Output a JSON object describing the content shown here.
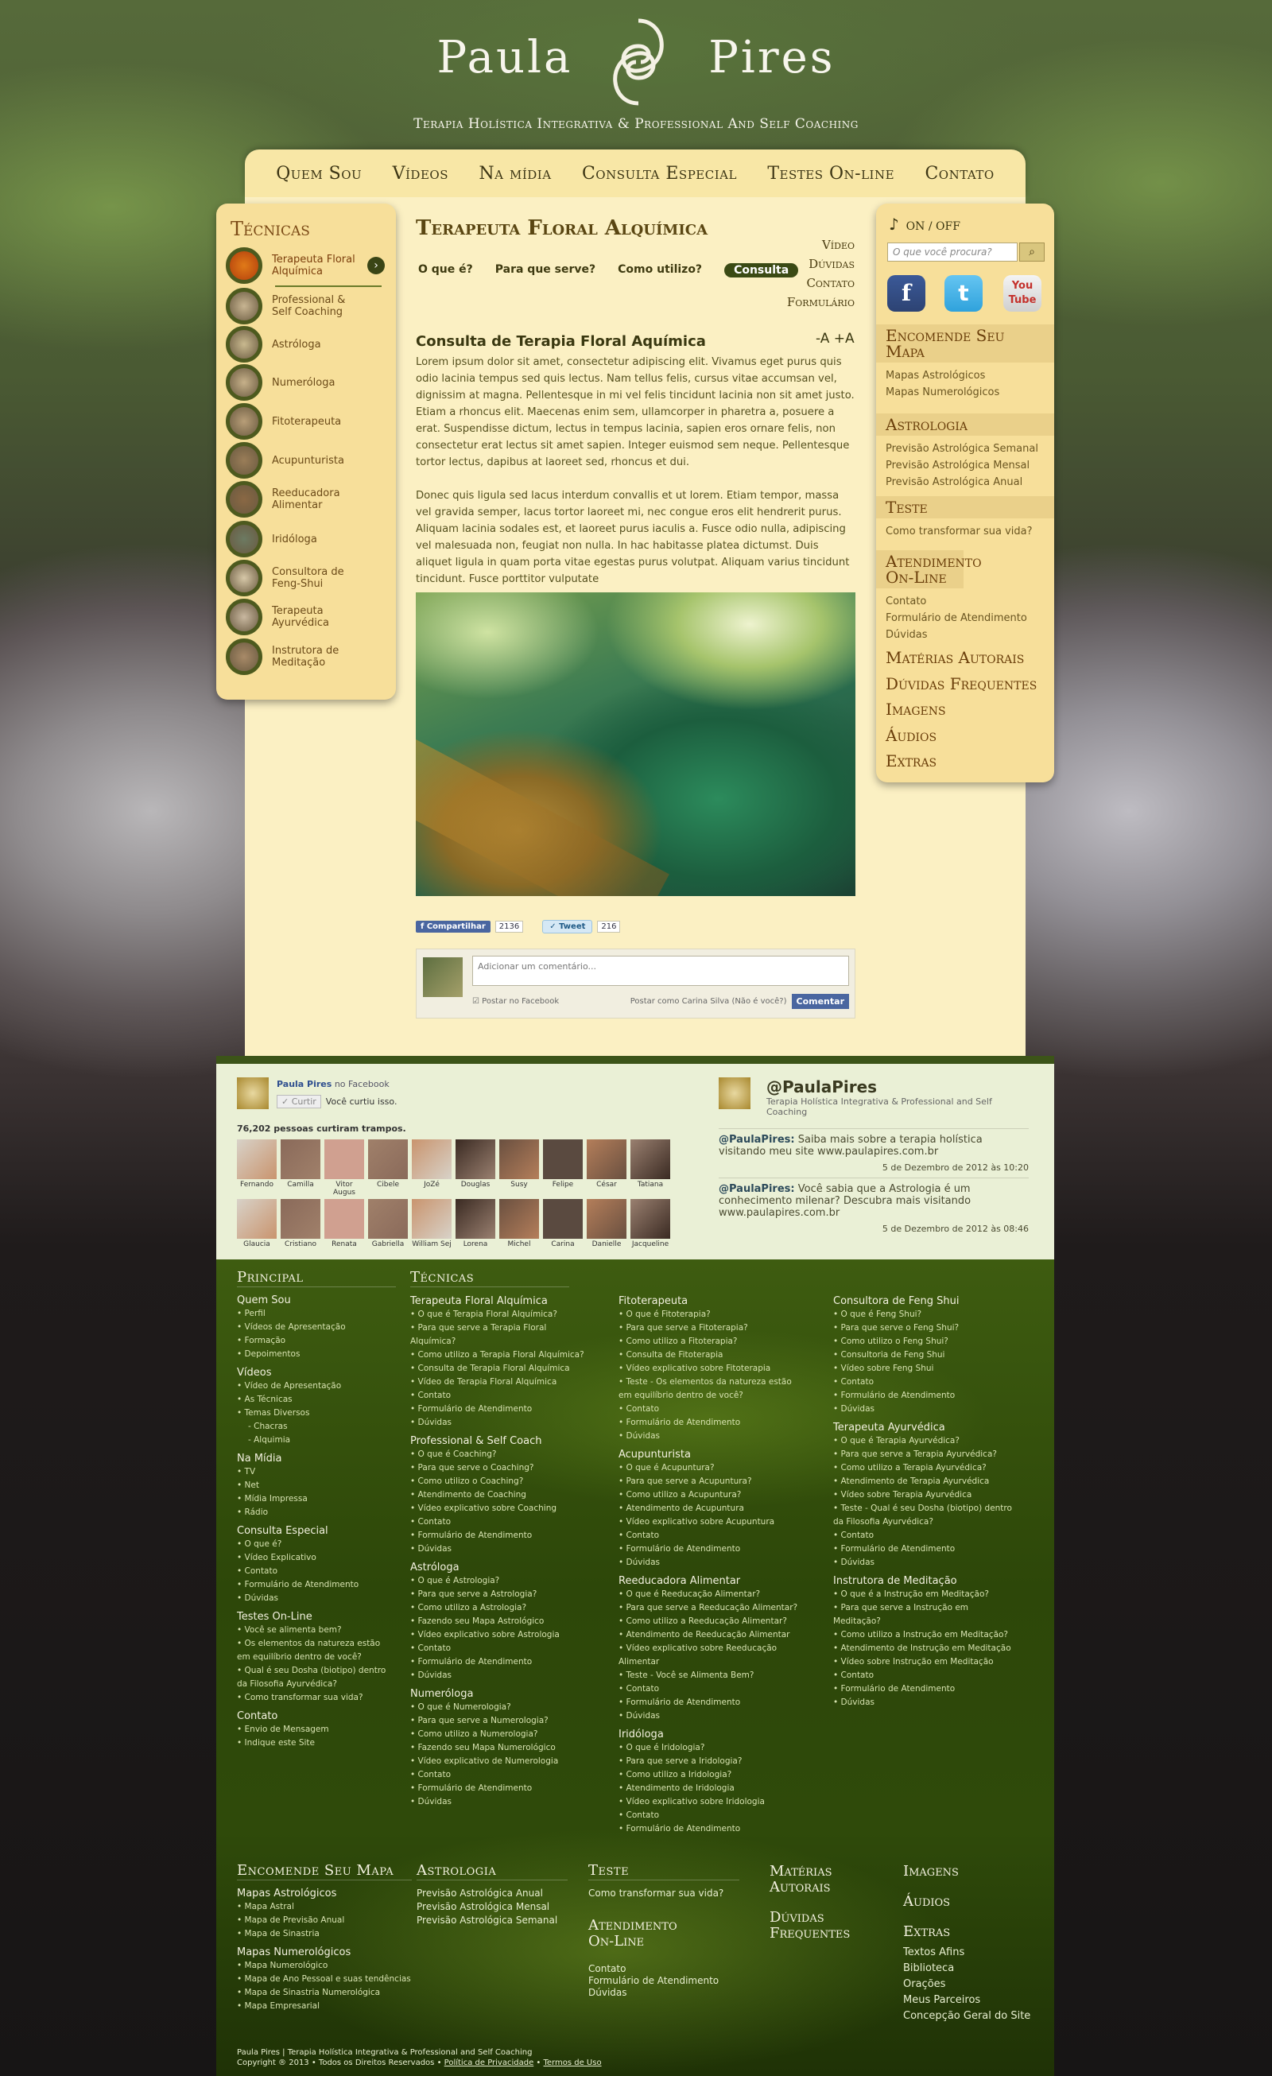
{
  "brand": {
    "name_left": "Paula",
    "name_right": "Pires",
    "tagline": "Terapia Holística Integrativa & Professional And Self Coaching"
  },
  "nav": [
    "Quem Sou",
    "Vídeos",
    "Na mídia",
    "Consulta Especial",
    "Testes On-line",
    "Contato"
  ],
  "techniques": {
    "title": "Técnicas",
    "items": [
      "Terapeuta Floral Alquímica",
      "Professional & Self Coaching",
      "Astróloga",
      "Numeróloga",
      "Fitoterapeuta",
      "Acupunturista",
      "Reeducadora Alimentar",
      "Iridóloga",
      "Consultora de Feng-Shui",
      "Terapeuta Ayurvédica",
      "Instrutora de Meditação"
    ],
    "arrow": "›"
  },
  "main": {
    "title": "Terapeuta Floral Alquímica",
    "tabs": [
      "O que é?",
      "Para que serve?",
      "Como utilizo?",
      "Consulta"
    ],
    "side_links": [
      "Vídeo",
      "Dúvidas",
      "Contato",
      "Formulário"
    ],
    "article_title": "Consulta de Terapia Floral Aquímica",
    "font_controls": "-A  +A",
    "p1": "Lorem ipsum dolor sit amet, consectetur adipiscing elit. Vivamus eget purus quis odio lacinia tempus sed quis lectus. Nam tellus felis, cursus vitae accumsan vel, dignissim at magna. Pellentesque in mi vel felis tincidunt lacinia non sit amet justo. Etiam a rhoncus elit. Maecenas enim sem, ullamcorper in pharetra a, posuere a erat. Suspendisse dictum, lectus in tempus lacinia, sapien eros ornare felis, non consectetur erat lectus sit amet sapien. Integer euismod sem neque. Pellentesque tortor lectus, dapibus at laoreet sed, rhoncus et dui.",
    "p2": "Donec quis ligula sed lacus interdum convallis et ut lorem. Etiam tempor, massa vel gravida semper, lacus tortor laoreet mi, nec congue eros elit hendrerit purus. Aliquam lacinia sodales est, et laoreet purus iaculis a. Fusce odio nulla, adipiscing vel malesuada non, feugiat non nulla. In hac habitasse platea dictumst. Duis aliquet ligula in quam porta vitae egestas purus volutpat. Aliquam varius tincidunt tincidunt. Fusce porttitor vulputate",
    "share_label": "Compartilhar",
    "share_count": "2136",
    "tweet_label": "Tweet",
    "tweet_count": "216",
    "comment_placeholder": "Adicionar um comentário...",
    "post_fb": "Postar no Facebook",
    "post_as": "Postar como Carina Silva (Não é você?)",
    "comment_btn": "Comentar"
  },
  "right": {
    "sound": "ON  /  OFF",
    "search_placeholder": "O que você procura?",
    "social": [
      "f",
      "t",
      "You Tube"
    ],
    "sections": [
      {
        "title": "Encomende Seu Mapa",
        "items": [
          "Mapas Astrológicos",
          "Mapas Numerológicos"
        ]
      },
      {
        "title": "Astrologia",
        "items": [
          "Previsão Astrológica Semanal",
          "Previsão Astrológica Mensal",
          "Previsão Astrológica Anual"
        ]
      },
      {
        "title": "Teste",
        "items": [
          "Como transformar sua vida?"
        ]
      },
      {
        "title": "Atendimento On-Line",
        "items": [
          "Contato",
          "Formulário de Atendimento",
          "Dúvidas"
        ]
      }
    ],
    "plain": [
      "Matérias Autorais",
      "Dúvidas Frequentes",
      "Imagens",
      "Áudios",
      "Extras"
    ]
  },
  "facebook": {
    "name": "Paula Pires",
    "suffix": "no Facebook",
    "like_btn": "Curtir",
    "liked": "Você curtiu isso.",
    "count": "76,202 pessoas curtiram trampos.",
    "people": [
      "Fernando",
      "Camilla",
      "Vitor Augus",
      "Cibele",
      "JoZé",
      "Douglas",
      "Susy",
      "Felipe",
      "César",
      "Tatiana",
      "Glaucia",
      "Cristiano",
      "Renata",
      "Gabriella",
      "William Sej",
      "Lorena",
      "Michel",
      "Carina",
      "Danielle",
      "Jacqueline"
    ]
  },
  "twitter": {
    "handle": "@PaulaPires",
    "desc": "Terapia Holística Integrativa & Professional and Self Coaching",
    "tweets": [
      {
        "user": "@PaulaPires:",
        "text": "Saiba mais sobre a terapia holística visitando meu site www.paulapires.com.br",
        "date": "5 de Dezembro de 2012 às 10:20"
      },
      {
        "user": "@PaulaPires:",
        "text": "Você sabia que a Astrologia é um conhecimento milenar? Descubra mais visitando www.paulapires.com.br",
        "date": "5 de Dezembro de 2012 às 08:46"
      }
    ]
  },
  "footer": {
    "principal": {
      "title": "Principal",
      "groups": [
        {
          "t": "Quem Sou",
          "i": [
            "Perfil",
            "Vídeos de Apresentação",
            "Formação",
            "Depoimentos"
          ]
        },
        {
          "t": "Vídeos",
          "i": [
            "Vídeo de Apresentação",
            "As Técnicas",
            "Temas Diversos"
          ],
          "sub": [
            "- Chacras",
            "- Alquimia"
          ]
        },
        {
          "t": "Na Mídia",
          "i": [
            "TV",
            "Net",
            "Mídia Impressa",
            "Rádio"
          ]
        },
        {
          "t": "Consulta Especial",
          "i": [
            "O que é?",
            "Vídeo Explicativo",
            "Contato",
            "Formulário de Atendimento",
            "Dúvidas"
          ]
        },
        {
          "t": "Testes On-Line",
          "i": [
            "Você se alimenta bem?",
            "Os elementos da natureza estão em equilíbrio dentro de você?",
            "Qual é seu Dosha (biotipo) dentro da Filosofia Ayurvédica?",
            "Como transformar sua vida?"
          ]
        },
        {
          "t": "Contato",
          "i": [
            "Envio de Mensagem",
            "Indique este Site"
          ]
        }
      ]
    },
    "tecnicas_title": "Técnicas",
    "tecnicas": [
      [
        {
          "t": "Terapeuta Floral Alquímica",
          "i": [
            "O que é Terapia Floral Alquímica?",
            "Para que serve a Terapia Floral Alquímica?",
            "Como utilizo a Terapia Floral Alquímica?",
            "Consulta de Terapia Floral Alquímica",
            "Vídeo de Terapia Floral Alquímica",
            "Contato",
            "Formulário de Atendimento",
            "Dúvidas"
          ]
        },
        {
          "t": "Professional & Self Coach",
          "i": [
            "O que é Coaching?",
            "Para que serve o Coaching?",
            "Como utilizo o Coaching?",
            "Atendimento de Coaching",
            "Vídeo explicativo sobre Coaching",
            "Contato",
            "Formulário de Atendimento",
            "Dúvidas"
          ]
        },
        {
          "t": "Astróloga",
          "i": [
            "O que é Astrologia?",
            "Para que serve a Astrologia?",
            "Como utilizo a Astrologia?",
            "Fazendo seu Mapa Astrológico",
            "Vídeo explicativo sobre Astrologia",
            "Contato",
            "Formulário de Atendimento",
            "Dúvidas"
          ]
        },
        {
          "t": "Numeróloga",
          "i": [
            "O que é Numerologia?",
            "Para que serve a Numerologia?",
            "Como utilizo a Numerologia?",
            "Fazendo seu Mapa Numerológico",
            "Vídeo explicativo de Numerologia",
            "Contato",
            "Formulário de Atendimento",
            "Dúvidas"
          ]
        }
      ],
      [
        {
          "t": "Fitoterapeuta",
          "i": [
            "O que é Fitoterapia?",
            "Para que serve a Fitoterapia?",
            "Como utilizo a Fitoterapia?",
            "Consulta de Fitoterapia",
            "Vídeo explicativo sobre Fitoterapia",
            "Teste - Os elementos da natureza estão em equilíbrio dentro de você?",
            "Contato",
            "Formulário de Atendimento",
            "Dúvidas"
          ]
        },
        {
          "t": "Acupunturista",
          "i": [
            "O que é Acupuntura?",
            "Para que serve a Acupuntura?",
            "Como utilizo a Acupuntura?",
            "Atendimento de Acupuntura",
            "Vídeo explicativo sobre Acupuntura",
            "Contato",
            "Formulário de Atendimento",
            "Dúvidas"
          ]
        },
        {
          "t": "Reeducadora Alimentar",
          "i": [
            "O que é Reeducação Alimentar?",
            "Para que serve a Reeducação Alimentar?",
            "Como utilizo a Reeducação Alimentar?",
            "Atendimento de Reeducação Alimentar",
            "Vídeo explicativo sobre Reeducação Alimentar",
            "Teste - Você se Alimenta Bem?",
            "Contato",
            "Formulário de Atendimento",
            "Dúvidas"
          ]
        },
        {
          "t": "Iridóloga",
          "i": [
            "O que é Iridologia?",
            "Para que serve a Iridologia?",
            "Como utilizo a Iridologia?",
            "Atendimento de Iridologia",
            "Vídeo explicativo sobre Iridologia",
            "Contato",
            "Formulário de Atendimento"
          ]
        }
      ],
      [
        {
          "t": "Consultora de Feng Shui",
          "i": [
            "O que é Feng Shui?",
            "Para que serve o Feng Shui?",
            "Como utilizo o Feng Shui?",
            "Consultoria de Feng Shui",
            "Vídeo sobre Feng Shui",
            "Contato",
            "Formulário de Atendimento",
            "Dúvidas"
          ]
        },
        {
          "t": "Terapeuta Ayurvédica",
          "i": [
            "O que é Terapia Ayurvédica?",
            "Para que serve a Terapia Ayurvédica?",
            "Como utilizo a Terapia Ayurvédica?",
            "Atendimento de Terapia Ayurvédica",
            "Vídeo sobre Terapia Ayurvédica",
            "Teste - Qual é seu Dosha (biotipo) dentro da Filosofia Ayurvédica?",
            "Contato",
            "Formulário de Atendimento",
            "Dúvidas"
          ]
        },
        {
          "t": "Instrutora de Meditação",
          "i": [
            "O que é a Instrução em Meditação?",
            "Para que serve a Instrução em Meditação?",
            "Como utilizo a Instrução em Meditação?",
            "Atendimento de Instrução em Meditação",
            "Vídeo sobre Instrução em Meditação",
            "Contato",
            "Formulário de Atendimento",
            "Dúvidas"
          ]
        }
      ]
    ],
    "encomende": {
      "title": "Encomende Seu Mapa",
      "groups": [
        {
          "t": "Mapas Astrológicos",
          "i": [
            "Mapa Astral",
            "Mapa de Previsão Anual",
            "Mapa de Sinastria"
          ]
        },
        {
          "t": "Mapas Numerológicos",
          "i": [
            "Mapa Numerológico",
            "Mapa de Ano Pessoal e suas tendências",
            "Mapa de Sinastria Numerológica",
            "Mapa Empresarial"
          ]
        }
      ]
    },
    "astrologia": {
      "title": "Astrologia",
      "items": [
        "Previsão Astrológica Anual",
        "Previsão Astrológica Mensal",
        "Previsão Astrológica Semanal"
      ]
    },
    "teste": {
      "title": "Teste",
      "items": [
        "Como transformar sua vida?"
      ]
    },
    "atendimento": {
      "title": "Atendimento On-Line",
      "items": [
        "Contato",
        "Formulário de Atendimento",
        "Dúvidas"
      ]
    },
    "materias": "Matérias Autorais",
    "duvidas": "Dúvidas Frequentes",
    "imagens": "Imagens",
    "audios": "Áudios",
    "extras": {
      "title": "Extras",
      "items": [
        "Textos Afins",
        "Biblioteca",
        "Orações",
        "Meus Parceiros",
        "Concepção Geral do Site"
      ]
    },
    "copyright1": "Paula Pires | Terapia Holística Integrativa & Professional and Self Coaching",
    "copyright2": "Copyright ® 2013 • Todos os Direitos Reservados •",
    "privacy": "Política de Privacidade",
    "terms": "Termos de Uso"
  },
  "colors": {
    "cream": "#fbf0c3",
    "sidebar": "#f7df9a",
    "green_dark": "#2d4709",
    "brown": "#6a3e0a"
  }
}
